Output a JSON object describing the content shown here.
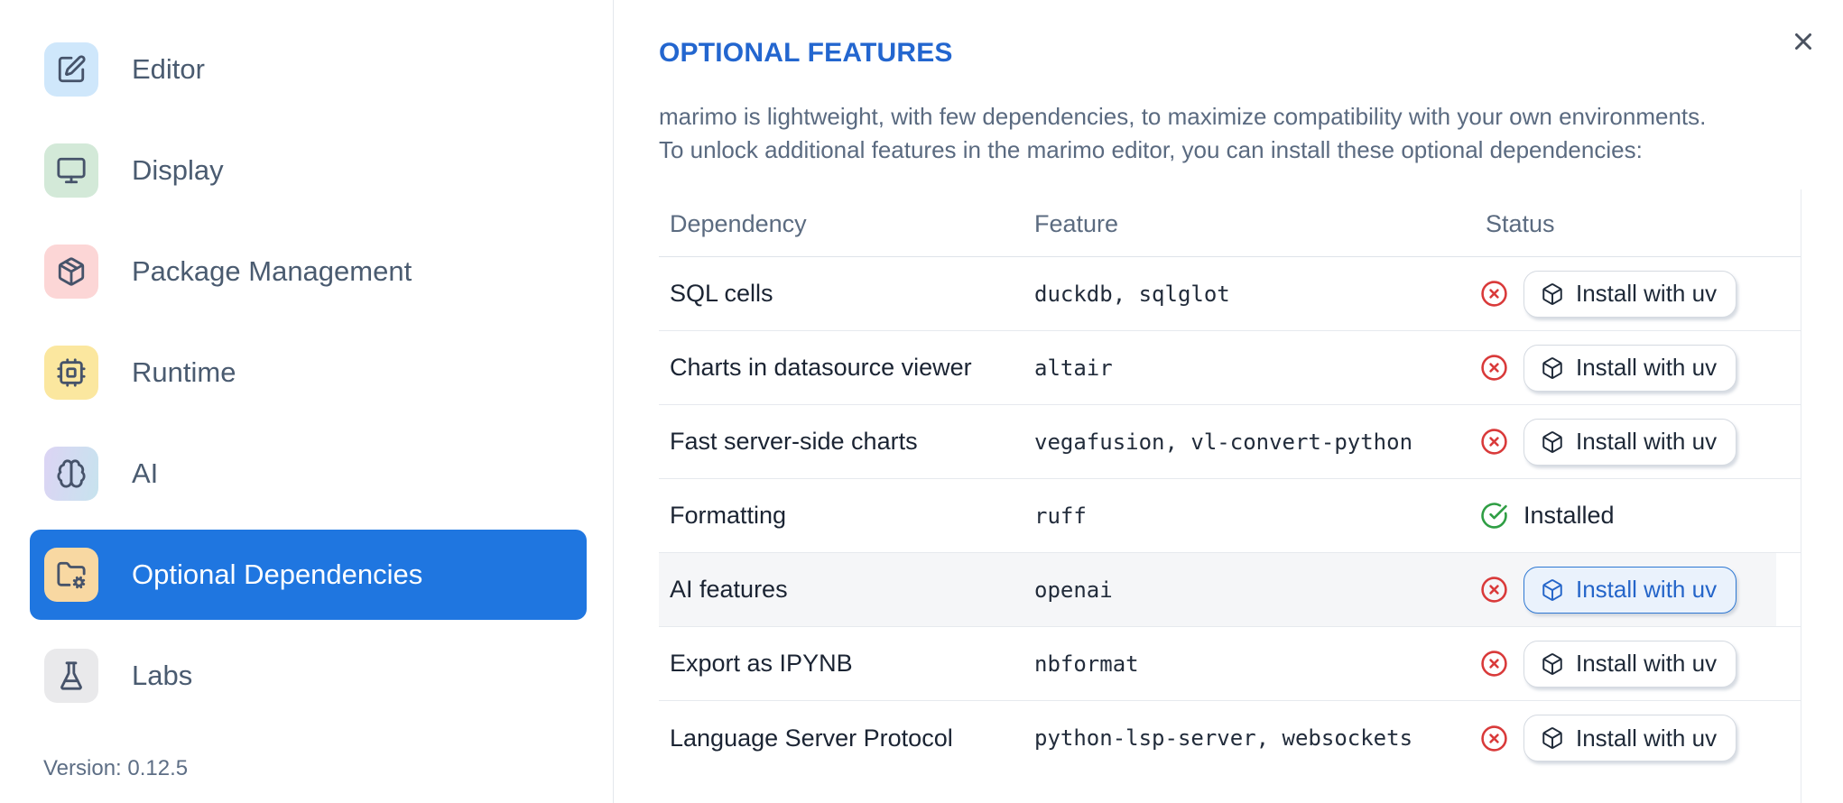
{
  "sidebar": {
    "items": [
      {
        "label": "Editor",
        "icon": "square-pen-icon",
        "chip": "#cfe7fb"
      },
      {
        "label": "Display",
        "icon": "monitor-icon",
        "chip": "#d3e9d8"
      },
      {
        "label": "Package Management",
        "icon": "package-icon",
        "chip": "#fcd6d6"
      },
      {
        "label": "Runtime",
        "icon": "cpu-icon",
        "chip": "#fbe79f"
      },
      {
        "label": "AI",
        "icon": "brain-icon",
        "chip": "#dcd4f4",
        "chip2": "#c7e3ee"
      },
      {
        "label": "Optional Dependencies",
        "icon": "folder-cog-icon",
        "chip": "#f8d8a2",
        "selected": true
      },
      {
        "label": "Labs",
        "icon": "flask-icon",
        "chip": "#e9e9eb"
      }
    ],
    "version_label": "Version: 0.12.5"
  },
  "panel": {
    "title": "OPTIONAL FEATURES",
    "description": [
      "marimo is lightweight, with few dependencies, to maximize compatibility with your own environments.",
      "To unlock additional features in the marimo editor, you can install these optional dependencies:"
    ]
  },
  "table": {
    "headers": [
      "Dependency",
      "Feature",
      "Status"
    ],
    "install_button_label": "Install with uv",
    "installed_label": "Installed",
    "rows": [
      {
        "dependency": "SQL cells",
        "feature": "duckdb, sqlglot",
        "installed": false
      },
      {
        "dependency": "Charts in datasource viewer",
        "feature": "altair",
        "installed": false
      },
      {
        "dependency": "Fast server-side charts",
        "feature": "vegafusion, vl-convert-python",
        "installed": false
      },
      {
        "dependency": "Formatting",
        "feature": "ruff",
        "installed": true
      },
      {
        "dependency": "AI features",
        "feature": "openai",
        "installed": false,
        "highlighted": true,
        "focused": true
      },
      {
        "dependency": "Export as IPYNB",
        "feature": "nbformat",
        "installed": false
      },
      {
        "dependency": "Language Server Protocol",
        "feature": "python-lsp-server, websockets",
        "installed": false
      }
    ]
  },
  "colors": {
    "accent_blue": "#1f76e0",
    "title_blue": "#2366cf",
    "focus_button_blue": "#2465c9",
    "error_red": "#d93a3a",
    "success_green": "#2f9e44"
  }
}
